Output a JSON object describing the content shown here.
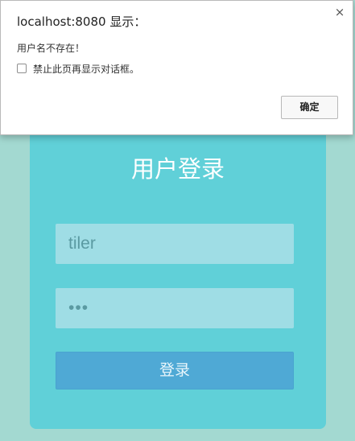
{
  "alert": {
    "title": "localhost:8080 显示：",
    "close_glyph": "×",
    "message": "用户名不存在！",
    "suppress_label": "禁止此页再显示对话框。",
    "ok_label": "确定"
  },
  "login": {
    "title": "用户登录",
    "username_value": "tiler",
    "password_value": "•••",
    "submit_label": "登录"
  },
  "colors": {
    "page_bg": "#a3d9d1",
    "card_bg": "#60d0d8",
    "input_bg": "#9fdde5",
    "button_bg": "#4fa9d5"
  }
}
